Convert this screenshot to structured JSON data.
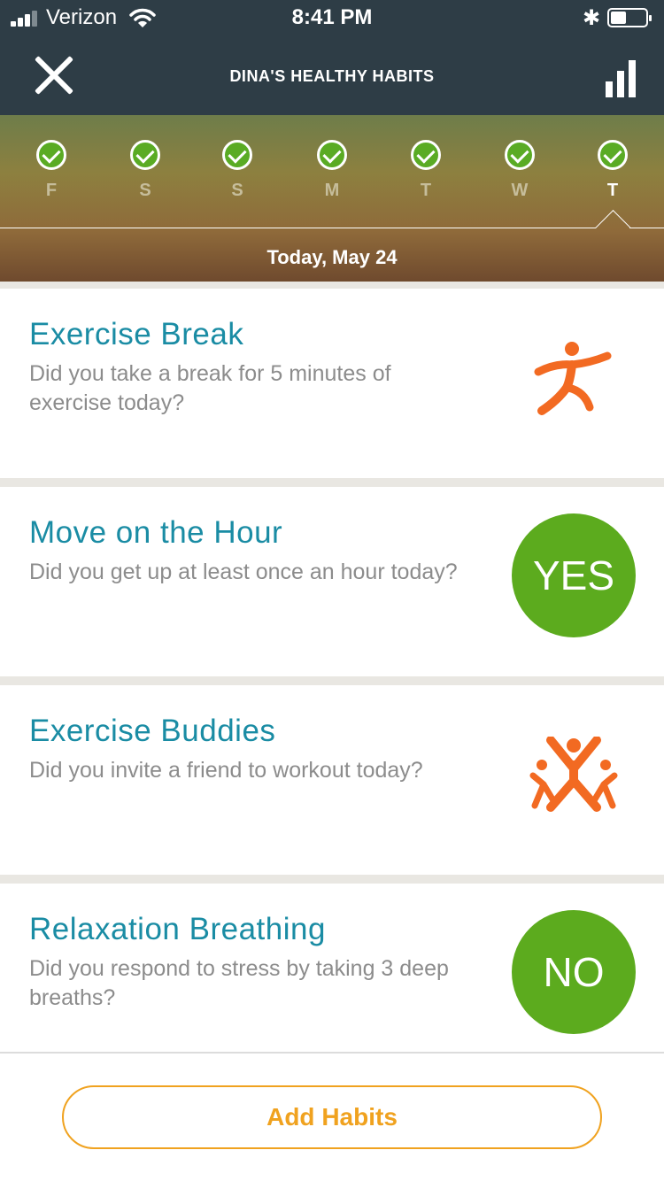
{
  "status_bar": {
    "carrier": "Verizon",
    "time": "8:41 PM",
    "battery_level": 0.45
  },
  "header": {
    "title": "DINA'S HEALTHY HABITS"
  },
  "week": {
    "days": [
      {
        "letter": "F",
        "checked": true
      },
      {
        "letter": "S",
        "checked": true
      },
      {
        "letter": "S",
        "checked": true
      },
      {
        "letter": "M",
        "checked": true
      },
      {
        "letter": "T",
        "checked": true
      },
      {
        "letter": "W",
        "checked": true
      },
      {
        "letter": "T",
        "checked": true,
        "selected": true
      }
    ],
    "today_label": "Today, May 24"
  },
  "habits": [
    {
      "title": "Exercise Break",
      "question": "Did you take a break for 5 minutes of exercise today?",
      "icon": "exercise-person-icon",
      "answer": ""
    },
    {
      "title": "Move on the Hour",
      "question": "Did you get up at least once an hour today?",
      "icon": "",
      "answer": "YES"
    },
    {
      "title": "Exercise Buddies",
      "question": "Did you invite a friend to workout today?",
      "icon": "exercise-group-icon",
      "answer": ""
    },
    {
      "title": "Relaxation Breathing",
      "question": "Did you respond to stress by taking 3 deep breaths?",
      "icon": "",
      "answer": "NO"
    }
  ],
  "footer": {
    "add_label": "Add Habits"
  },
  "colors": {
    "header_bg": "#2e3d46",
    "habit_title": "#1a8ca4",
    "answer_green": "#5cab1e",
    "icon_orange": "#f26a22",
    "add_button": "#f0a21f"
  }
}
